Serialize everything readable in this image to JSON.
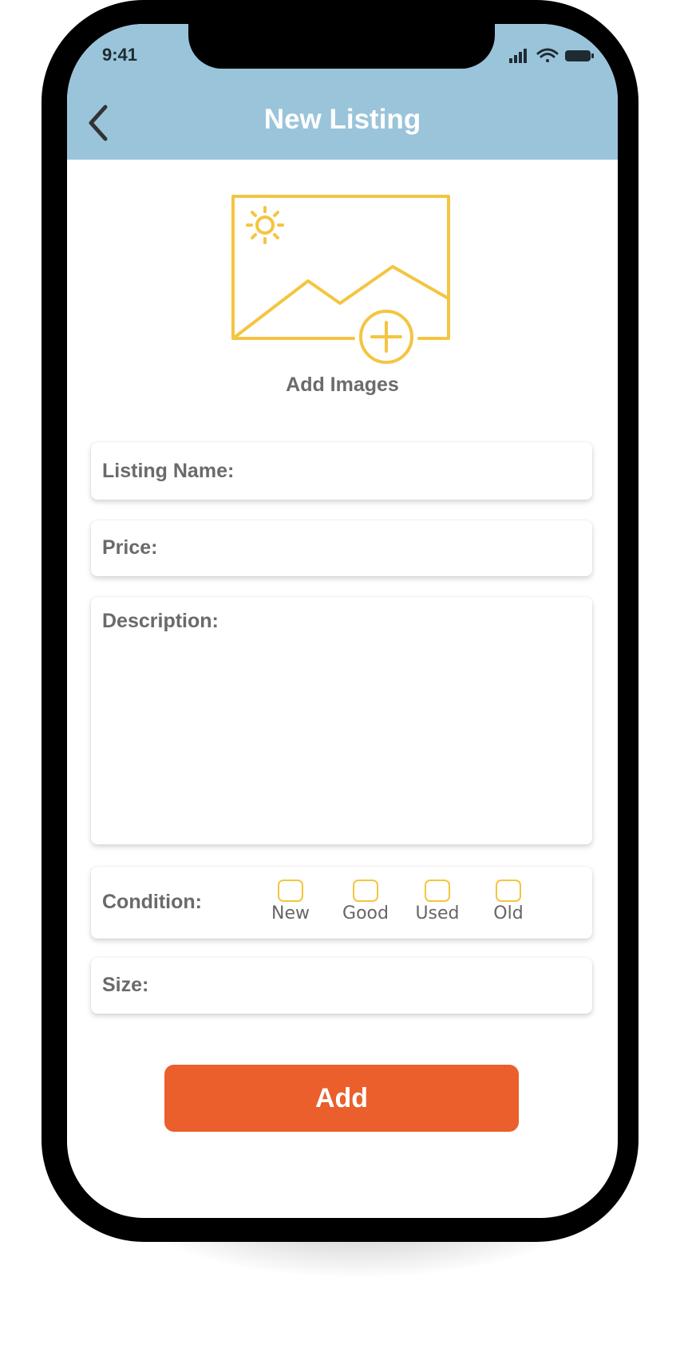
{
  "status_bar": {
    "time": "9:41",
    "signal_icon": "cellular-signal-icon",
    "wifi_icon": "wifi-icon",
    "battery_icon": "battery-icon"
  },
  "header": {
    "title": "New Listing",
    "back_icon": "chevron-left-icon",
    "background_color": "#9ac4da"
  },
  "image_picker": {
    "label": "Add Images",
    "icon": "add-image-icon",
    "accent_color": "#f4c541"
  },
  "form": {
    "listing_name_label": "Listing Name:",
    "price_label": "Price:",
    "description_label": "Description:",
    "condition": {
      "label": "Condition:",
      "options": [
        "New",
        "Good",
        "Used",
        "Old"
      ]
    },
    "size_label": "Size:"
  },
  "submit": {
    "label": "Add",
    "color": "#ea5f2c"
  }
}
